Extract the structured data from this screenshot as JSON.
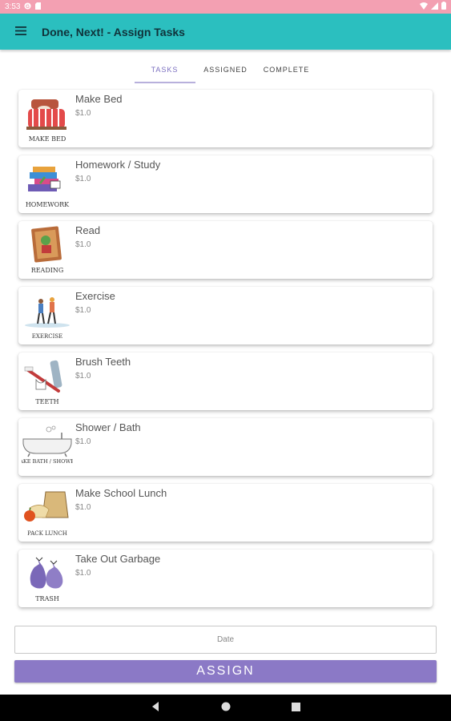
{
  "status_bar": {
    "time": "3:53"
  },
  "app_bar": {
    "title": "Done, Next! - Assign Tasks",
    "menu_icon": "menu-icon"
  },
  "tabs": [
    {
      "label": "TASKS",
      "active": true
    },
    {
      "label": "ASSIGNED",
      "active": false
    },
    {
      "label": "COMPLETE",
      "active": false
    }
  ],
  "tasks": [
    {
      "name": "Make Bed",
      "price": "$1.0",
      "image_caption": "MAKE BED",
      "icon": "bed-icon"
    },
    {
      "name": "Homework / Study",
      "price": "$1.0",
      "image_caption": "HOMEWORK",
      "icon": "books-icon"
    },
    {
      "name": "Read",
      "price": "$1.0",
      "image_caption": "READING",
      "icon": "book-icon"
    },
    {
      "name": "Exercise",
      "price": "$1.0",
      "image_caption": "EXERCISE",
      "icon": "exercise-icon"
    },
    {
      "name": "Brush Teeth",
      "price": "$1.0",
      "image_caption": "TEETH",
      "icon": "toothbrush-icon"
    },
    {
      "name": "Shower / Bath",
      "price": "$1.0",
      "image_caption": "TAKE BATH / SHOWER",
      "icon": "bathtub-icon"
    },
    {
      "name": "Make School Lunch",
      "price": "$1.0",
      "image_caption": "PACK LUNCH",
      "icon": "lunch-bag-icon"
    },
    {
      "name": "Take Out Garbage",
      "price": "$1.0",
      "image_caption": "TRASH",
      "icon": "trash-bags-icon"
    }
  ],
  "date_field": {
    "placeholder": "Date"
  },
  "assign_button": {
    "label": "ASSIGN"
  },
  "colors": {
    "status_bar": "#f3a0b2",
    "app_bar": "#2bbfbf",
    "accent": "#8b79c6",
    "active_tab": "#7b6fc0"
  }
}
